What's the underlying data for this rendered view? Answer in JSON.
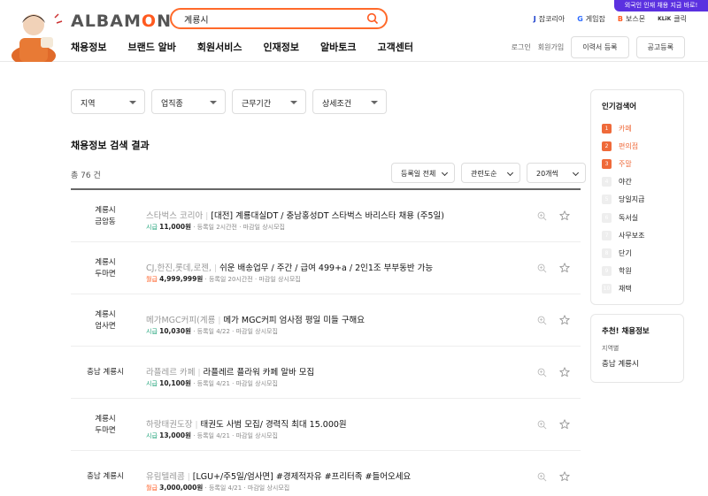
{
  "header": {
    "logo_prefix": "ALBAM",
    "logo_o": "O",
    "logo_suffix": "N",
    "search_value": "계룡시",
    "promo": "외국인 인재 채용 지금 바로!",
    "sites": [
      {
        "mark": "J",
        "label": "잡코리아",
        "color": "#1a3dcc"
      },
      {
        "mark": "G",
        "label": "게임잡",
        "color": "#2d6cff"
      },
      {
        "mark": "B",
        "label": "보스몬",
        "color": "#ff5a1f"
      },
      {
        "mark": "KLiK",
        "label": "클릭",
        "color": "#222222"
      }
    ],
    "nav": [
      "채용정보",
      "브랜드 알바",
      "회원서비스",
      "인재정보",
      "알바토크",
      "고객센터"
    ],
    "login": "로그인",
    "signup": "회원가입",
    "resume_btn": "이력서 등록",
    "post_btn": "공고등록"
  },
  "filters": [
    "지역",
    "업직종",
    "근무기간",
    "상세조건"
  ],
  "results": {
    "title": "채용정보 검색 결과",
    "count": "총 76 건",
    "sorts": [
      "등록일 전체",
      "관련도순",
      "20개씩"
    ]
  },
  "jobs": [
    {
      "loc1": "계룡시",
      "loc2": "금암동",
      "company": "스타벅스 코리아",
      "title": "[대전] 계룡대실DT / 충남홍성DT 스타벅스 바리스타 채용 (주5일)",
      "pay_type": "시급",
      "pay_color": "green",
      "amount": "11,000원",
      "posted": "등록일 2시간전",
      "deadline": "마감일 상시모집"
    },
    {
      "loc1": "계룡시",
      "loc2": "두마면",
      "company": "CJ,한진,롯데,로젠,",
      "title": "쉬운 배송업무 / 주간 / 급여 499+a / 2인1조 부부동반 가능",
      "pay_type": "월급",
      "pay_color": "orange",
      "amount": "4,999,999원",
      "posted": "등록일 20시간전",
      "deadline": "마감일 상시모집"
    },
    {
      "loc1": "계룡시",
      "loc2": "엄사면",
      "company": "메가MGC커피(계룡",
      "title": "메가 MGC커피 엄사점 평일 미들 구해요",
      "pay_type": "시급",
      "pay_color": "green",
      "amount": "10,030원",
      "posted": "등록일 4/22",
      "deadline": "마감일 상시모집"
    },
    {
      "loc1": "충남 계룡시",
      "loc2": "",
      "company": "라플레르 카페",
      "title": "라플레르 플라워 카페 알바 모집",
      "pay_type": "시급",
      "pay_color": "green",
      "amount": "10,100원",
      "posted": "등록일 4/21",
      "deadline": "마감일 상시모집"
    },
    {
      "loc1": "계룡시",
      "loc2": "두마면",
      "company": "하랑태권도장",
      "title": "태권도 사범 모집/ 경력직 최대 15.000원",
      "pay_type": "시급",
      "pay_color": "green",
      "amount": "13,000원",
      "posted": "등록일 4/21",
      "deadline": "마감일 상시모집"
    },
    {
      "loc1": "충남 계룡시",
      "loc2": "",
      "company": "유림텔레콤",
      "title": "[LGU+/주5일/엄사면] #경제적자유 #프리터족 #들어오세요",
      "pay_type": "월급",
      "pay_color": "orange",
      "amount": "3,000,000원",
      "posted": "등록일 4/21",
      "deadline": "마감일 상시모집"
    }
  ],
  "sidebar": {
    "popular_title": "인기검색어",
    "popular": [
      {
        "n": "1",
        "word": "카페",
        "top": true
      },
      {
        "n": "2",
        "word": "편의점",
        "top": true
      },
      {
        "n": "3",
        "word": "주말",
        "top": true
      },
      {
        "n": "4",
        "word": "야간",
        "top": false
      },
      {
        "n": "5",
        "word": "당일지급",
        "top": false
      },
      {
        "n": "6",
        "word": "독서실",
        "top": false
      },
      {
        "n": "7",
        "word": "사무보조",
        "top": false
      },
      {
        "n": "8",
        "word": "단기",
        "top": false
      },
      {
        "n": "9",
        "word": "학원",
        "top": false
      },
      {
        "n": "10",
        "word": "재택",
        "top": false
      }
    ],
    "recommend_title": "추천! 채용정보",
    "recommend_sub": "지역별",
    "recommend_val": "충남 계룡시"
  }
}
